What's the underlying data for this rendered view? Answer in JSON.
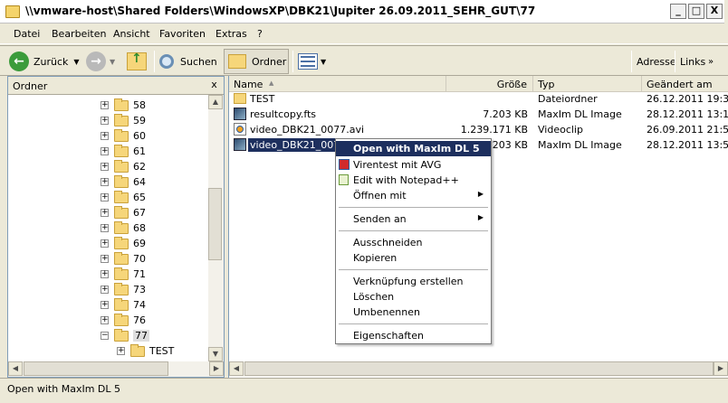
{
  "window": {
    "title": "\\\\vmware-host\\Shared Folders\\WindowsXP\\DBK21\\Jupiter 26.09.2011_SEHR_GUT\\77",
    "minimize": "_",
    "maximize": "□",
    "close": "X"
  },
  "menu": [
    "Datei",
    "Bearbeiten",
    "Ansicht",
    "Favoriten",
    "Extras",
    "?"
  ],
  "toolbar": {
    "back": "Zurück",
    "search": "Suchen",
    "folders": "Ordner",
    "address": "Adresse",
    "links": "Links"
  },
  "leftpane": {
    "title": "Ordner",
    "close": "x",
    "items": [
      {
        "label": "58",
        "expander": "+"
      },
      {
        "label": "59",
        "expander": "+"
      },
      {
        "label": "60",
        "expander": "+"
      },
      {
        "label": "61",
        "expander": "+"
      },
      {
        "label": "62",
        "expander": "+"
      },
      {
        "label": "64",
        "expander": "+"
      },
      {
        "label": "65",
        "expander": "+"
      },
      {
        "label": "67",
        "expander": "+"
      },
      {
        "label": "68",
        "expander": "+"
      },
      {
        "label": "69",
        "expander": "+"
      },
      {
        "label": "70",
        "expander": "+"
      },
      {
        "label": "71",
        "expander": "+"
      },
      {
        "label": "73",
        "expander": "+"
      },
      {
        "label": "74",
        "expander": "+"
      },
      {
        "label": "76",
        "expander": "+"
      },
      {
        "label": "77",
        "expander": "−"
      }
    ],
    "child": {
      "label": "TEST",
      "expander": "+"
    }
  },
  "columns": {
    "name": "Name",
    "size": "Größe",
    "type": "Typ",
    "modified": "Geändert am"
  },
  "files": [
    {
      "name": "TEST",
      "size": "",
      "type": "Dateiordner",
      "modified": "26.12.2011 19:36",
      "icon": "folder-icon"
    },
    {
      "name": "resultcopy.fts",
      "size": "7.203 KB",
      "type": "MaxIm DL Image",
      "modified": "28.12.2011 13:12",
      "icon": "maxim-image-icon"
    },
    {
      "name": "video_DBK21_0077.avi",
      "size": "1.239.171 KB",
      "type": "Videoclip",
      "modified": "26.09.2011 21:58",
      "icon": "video-icon"
    },
    {
      "name": "video_DBK21_0077.",
      "size": "7.203 KB",
      "type": "MaxIm DL Image",
      "modified": "28.12.2011 13:55",
      "icon": "maxim-image-icon"
    }
  ],
  "context_menu": {
    "open_with_maxim": "Open with MaxIm DL 5",
    "virentest": "Virentest mit AVG",
    "notepad": "Edit with Notepad++",
    "oeffnen_mit": "Öffnen mit",
    "senden_an": "Senden an",
    "ausschneiden": "Ausschneiden",
    "kopieren": "Kopieren",
    "verknuepfung": "Verknüpfung erstellen",
    "loeschen": "Löschen",
    "umbenennen": "Umbenennen",
    "eigenschaften": "Eigenschaften"
  },
  "status": "Open with MaxIm DL 5"
}
